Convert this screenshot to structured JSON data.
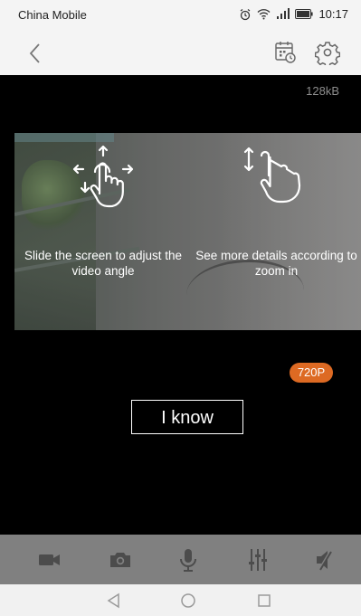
{
  "status_bar": {
    "carrier": "China Mobile",
    "time": "10:17",
    "icons": [
      "alarm-icon",
      "wifi-icon",
      "signal-icon",
      "battery-icon"
    ]
  },
  "toolbar": {
    "back_icon": "chevron-left-icon",
    "calendar_icon": "calendar-playback-icon",
    "settings_icon": "gear-icon"
  },
  "video": {
    "bitrate": "128kB",
    "quality": "720P"
  },
  "guide": {
    "left_tip": "Slide the screen to adjust the video angle",
    "right_tip": "See more details according to zoom in",
    "confirm_label": "I know"
  },
  "controls": {
    "items": [
      "record-video-icon",
      "snapshot-camera-icon",
      "microphone-icon",
      "equalizer-icon",
      "speaker-muted-icon"
    ]
  },
  "nav": {
    "items": [
      "nav-back-icon",
      "nav-home-icon",
      "nav-recents-icon"
    ]
  },
  "colors": {
    "accent": "#dd6a23",
    "bar_bg": "#f4f4f4",
    "control_bg": "#808080"
  }
}
